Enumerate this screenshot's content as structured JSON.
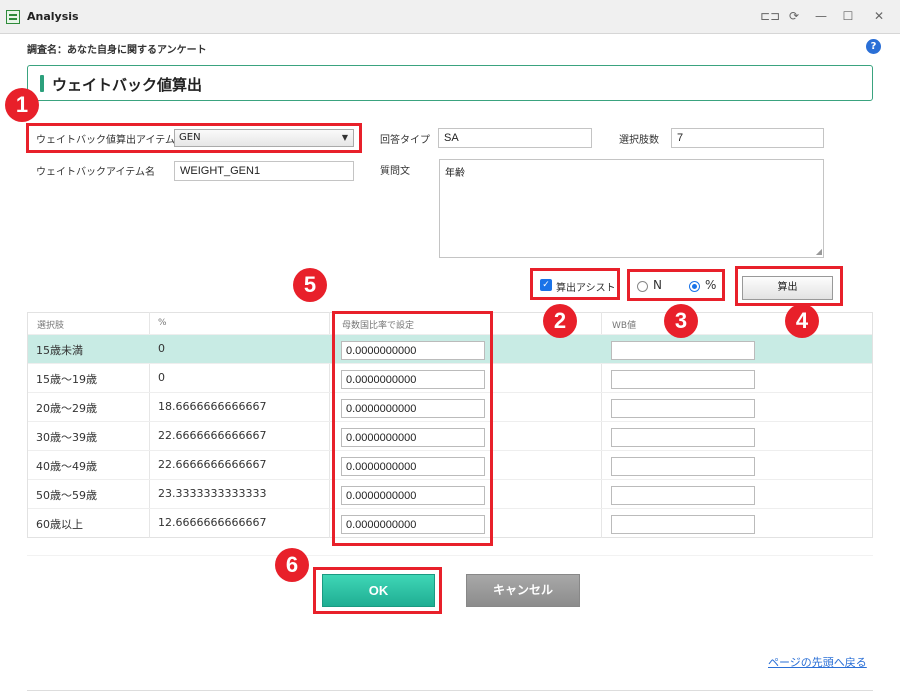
{
  "window": {
    "title": "Analysis",
    "controls": [
      "⊏⊐",
      "⟳",
      "—",
      "☐",
      "✕"
    ]
  },
  "survey": {
    "label": "調査名：あなた自身に関するアンケート"
  },
  "section": {
    "title": "ウェイトバック値算出"
  },
  "form": {
    "item_label": "ウェイトバック値算出アイテム",
    "item_value": "GEN",
    "item_name_label": "ウェイトバックアイテム名",
    "item_name_value": "WEIGHT_GEN1",
    "answer_type_label": "回答タイプ",
    "answer_type_value": "SA",
    "choices_count_label": "選択肢数",
    "choices_count_value": "7",
    "question_label": "質問文",
    "question_value": "年齢"
  },
  "controls": {
    "assist_label": "算出アシスト",
    "radio_n_label": "N",
    "radio_pct_label": "%",
    "calc_button": "算出"
  },
  "table": {
    "headers": [
      "選択肢",
      "%",
      "母数国比率で設定",
      "WB値"
    ],
    "rows": [
      {
        "choice": "15歳未満",
        "pct": "0",
        "ratio": "0.0000000000",
        "wb": ""
      },
      {
        "choice": "15歳～19歳",
        "pct": "0",
        "ratio": "0.0000000000",
        "wb": ""
      },
      {
        "choice": "20歳～29歳",
        "pct": "18.6666666666667",
        "ratio": "0.0000000000",
        "wb": ""
      },
      {
        "choice": "30歳～39歳",
        "pct": "22.6666666666667",
        "ratio": "0.0000000000",
        "wb": ""
      },
      {
        "choice": "40歳～49歳",
        "pct": "22.6666666666667",
        "ratio": "0.0000000000",
        "wb": ""
      },
      {
        "choice": "50歳～59歳",
        "pct": "23.3333333333333",
        "ratio": "0.0000000000",
        "wb": ""
      },
      {
        "choice": "60歳以上",
        "pct": "12.6666666666667",
        "ratio": "0.0000000000",
        "wb": ""
      }
    ]
  },
  "buttons": {
    "ok": "OK",
    "cancel": "キャンセル"
  },
  "links": {
    "back_to_top": "ページの先頭へ戻る"
  },
  "callouts": [
    "1",
    "2",
    "3",
    "4",
    "5",
    "6"
  ],
  "colors": {
    "accent": "#2ca07c",
    "highlight": "#e8202a",
    "ok": "#1fae93",
    "row_highlight": "#c8ebe4"
  }
}
